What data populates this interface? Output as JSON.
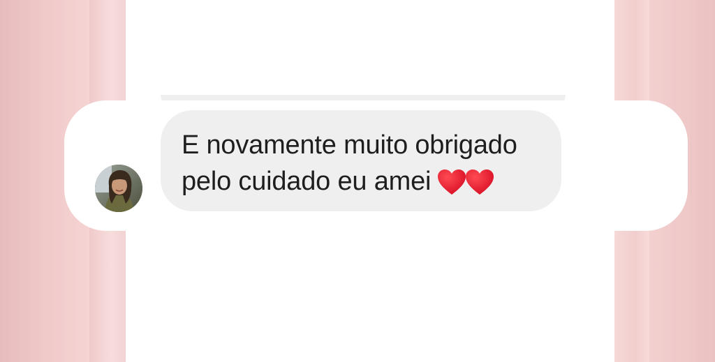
{
  "message": {
    "line1": "E novamente muito obrigado",
    "line2": "pelo cuidado eu amei",
    "emoji": [
      "red-heart",
      "red-heart"
    ],
    "bubble_color": "#efefef",
    "text_color": "#1e1e1e"
  },
  "sender": {
    "avatar_icon": "profile-photo"
  },
  "colors": {
    "background": "#f6d4d3",
    "screen": "#ffffff",
    "heart": "#e0102a"
  }
}
